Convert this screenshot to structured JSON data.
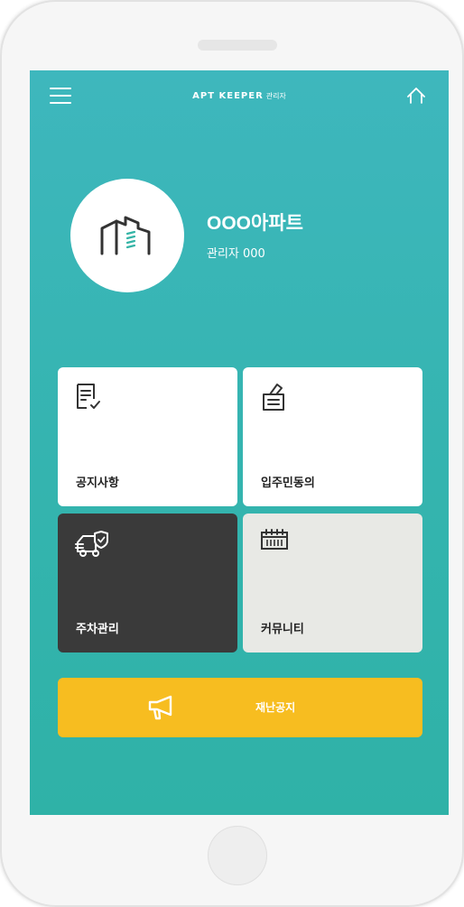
{
  "header": {
    "brand": "APT KEEPER",
    "brand_sub": "관리자"
  },
  "profile": {
    "apartment_name": "OOO아파트",
    "admin_label": "관리자 000"
  },
  "menu": {
    "cards": [
      {
        "label": "공지사항",
        "icon": "document-check-icon"
      },
      {
        "label": "입주민동의",
        "icon": "ballot-box-icon"
      },
      {
        "label": "주차관리",
        "icon": "vehicle-shield-icon"
      },
      {
        "label": "커뮤니티",
        "icon": "calendar-icon"
      }
    ]
  },
  "notice_bar": {
    "label": "재난공지",
    "icon": "megaphone-icon"
  },
  "colors": {
    "screen_top": "#3eb7bd",
    "screen_bottom": "#2fb2a7",
    "notice_yellow": "#f7bd20",
    "parking_dark": "#3a3a3a",
    "community_gray": "#e8e9e5"
  }
}
